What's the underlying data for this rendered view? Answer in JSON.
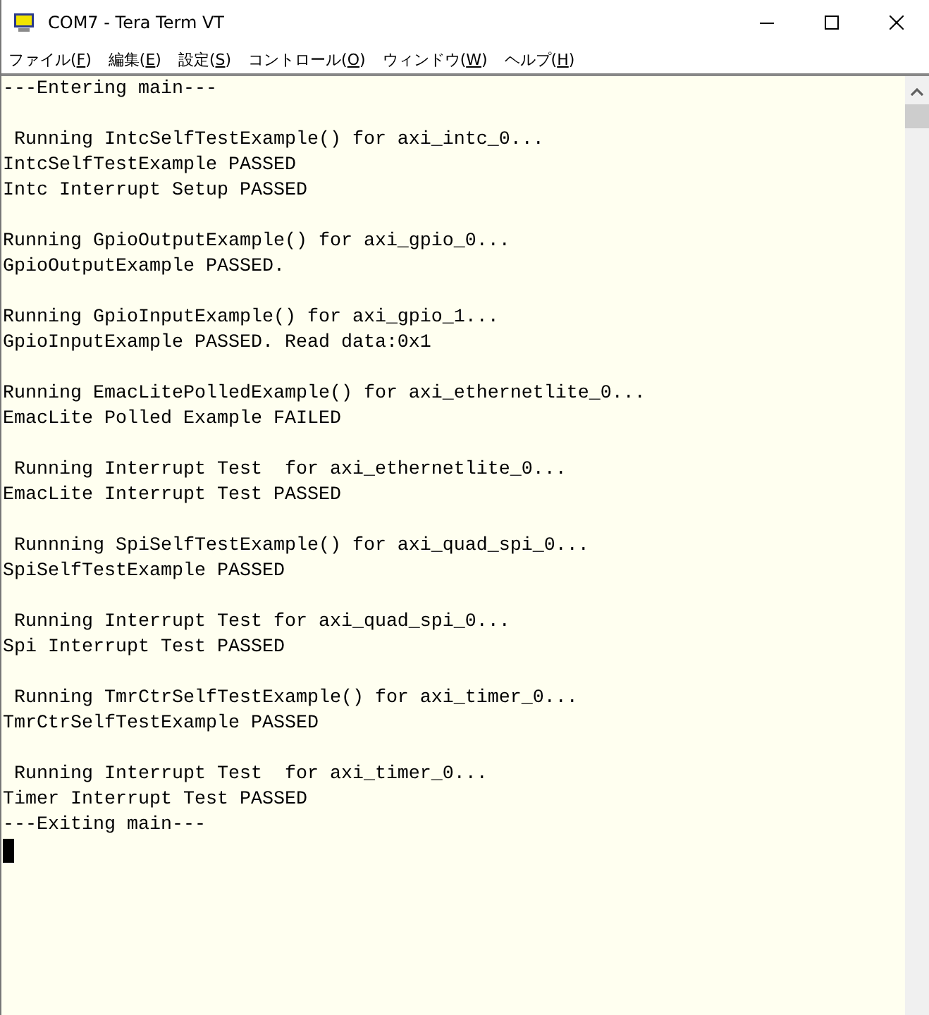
{
  "window": {
    "title": "COM7 - Tera Term VT"
  },
  "menu": [
    "ファイル(F)",
    "編集(E)",
    "設定(S)",
    "コントロール(O)",
    "ウィンドウ(W)",
    "ヘルプ(H)"
  ],
  "terminal": {
    "blocks": [
      [
        "---Entering main---"
      ],
      [
        " Running IntcSelfTestExample() for axi_intc_0...",
        "IntcSelfTestExample PASSED",
        "Intc Interrupt Setup PASSED"
      ],
      [
        "Running GpioOutputExample() for axi_gpio_0...",
        "GpioOutputExample PASSED."
      ],
      [
        "Running GpioInputExample() for axi_gpio_1...",
        "GpioInputExample PASSED. Read data:0x1"
      ],
      [
        "Running EmacLitePolledExample() for axi_ethernetlite_0...",
        "EmacLite Polled Example FAILED"
      ],
      [
        " Running Interrupt Test  for axi_ethernetlite_0...",
        "EmacLite Interrupt Test PASSED"
      ],
      [
        " Runnning SpiSelfTestExample() for axi_quad_spi_0...",
        "SpiSelfTestExample PASSED"
      ],
      [
        " Running Interrupt Test for axi_quad_spi_0...",
        "Spi Interrupt Test PASSED"
      ],
      [
        " Running TmrCtrSelfTestExample() for axi_timer_0...",
        "TmrCtrSelfTestExample PASSED"
      ],
      [
        " Running Interrupt Test  for axi_timer_0...",
        "Timer Interrupt Test PASSED",
        "---Exiting main---"
      ]
    ]
  }
}
